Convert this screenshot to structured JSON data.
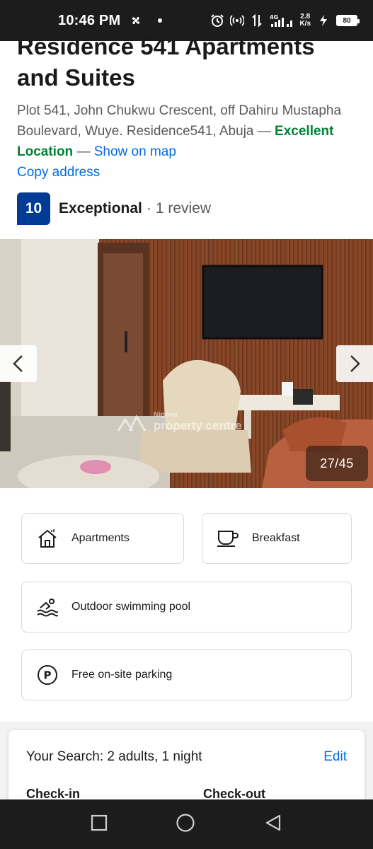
{
  "status_bar": {
    "time": "10:46 PM",
    "network": "4G",
    "speed_top": "2.8",
    "speed_bottom": "K/s",
    "battery": "80"
  },
  "property": {
    "title_line1": "Residence 541 Apartments",
    "title_line2": "and Suites",
    "address": "Plot 541, John Chukwu Crescent, off Dahiru Mustapha Boulevard, Wuye. Residence541, Abuja",
    "dash1": " — ",
    "location_badge": "Excellent Location",
    "dash2": " — ",
    "map_link": "Show on map",
    "copy_link": "Copy address",
    "score": "10",
    "rating_word": "Exceptional",
    "rating_sep": "·",
    "reviews": "1 review"
  },
  "gallery": {
    "counter": "27/45",
    "watermark_top": "Nigeria",
    "watermark_main": "property centre"
  },
  "facilities": [
    {
      "label": "Apartments",
      "icon": "apartment-icon"
    },
    {
      "label": "Breakfast",
      "icon": "coffee-cup-icon"
    },
    {
      "label": "Outdoor swimming pool",
      "icon": "swimming-icon"
    },
    {
      "label": "Free on-site parking",
      "icon": "parking-icon"
    }
  ],
  "search": {
    "summary": "Your Search: 2 adults, 1 night",
    "edit": "Edit",
    "check_in": "Check-in",
    "check_out": "Check-out"
  },
  "colors": {
    "brand_blue": "#003b95",
    "link_blue": "#006ce4",
    "good_green": "#008234"
  }
}
